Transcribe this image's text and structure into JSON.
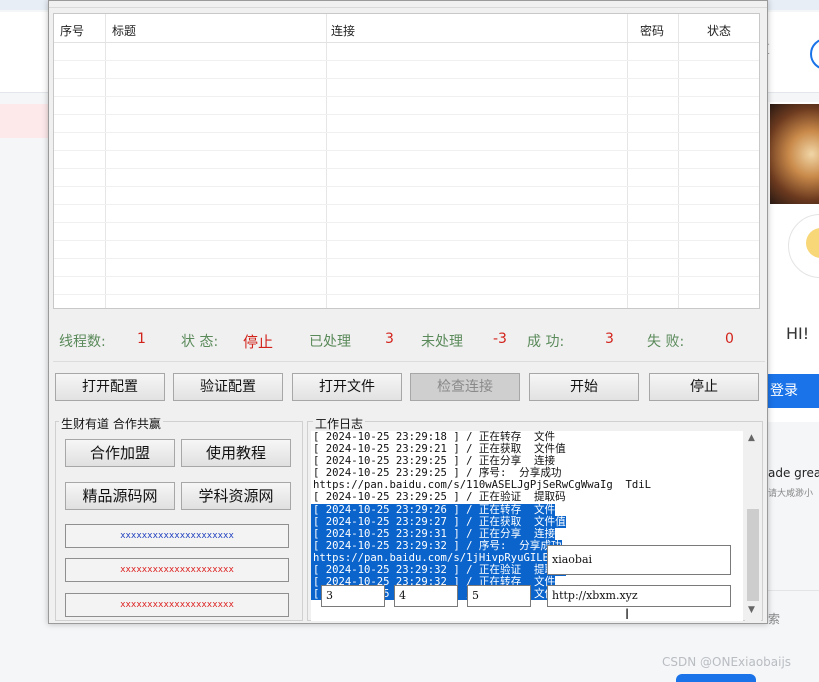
{
  "background": {
    "hi_text": "HI!",
    "login_label": "登录",
    "snippet1": "ade grea",
    "snippet2": "请大咸渺小",
    "snippet3": "索",
    "watermark": "CSDN @ONExiaobaijs"
  },
  "grid": {
    "columns": [
      "序号",
      "标题",
      "连接",
      "密码",
      "状态"
    ]
  },
  "stats": {
    "threads_label": "线程数:",
    "threads_value": "1",
    "status_label": "状 态:",
    "status_value": "停止",
    "processed_label": "已处理",
    "processed_value": "3",
    "unprocessed_label": "未处理",
    "unprocessed_value": "-3",
    "success_label": "成 功:",
    "success_value": "3",
    "fail_label": "失 败:",
    "fail_value": "0"
  },
  "toolbar": {
    "open_config": "打开配置",
    "verify_config": "验证配置",
    "open_file": "打开文件",
    "check_link": "检查连接",
    "start": "开始",
    "stop": "停止"
  },
  "left_panel": {
    "title": "生财有道 合作共赢",
    "join": "合作加盟",
    "tutorial": "使用教程",
    "source_site": "精品源码网",
    "resource_site": "学科资源网",
    "x_buttons": [
      "xxxxxxxxxxxxxxxxxxxxx",
      "xxxxxxxxxxxxxxxxxxxxx",
      "xxxxxxxxxxxxxxxxxxxxx"
    ],
    "x_colors": [
      "#1f3fbf",
      "#d22",
      "#d22"
    ]
  },
  "log_panel": {
    "title": "工作日志",
    "lines": [
      "[ 2024-10-25 23:29:18 ] / 正在转存  文件",
      "[ 2024-10-25 23:29:21 ] / 正在获取  文件值",
      "[ 2024-10-25 23:29:25 ] / 正在分享  连接",
      "[ 2024-10-25 23:29:25 ] / 序号:  分享成功",
      "https://pan.baidu.com/s/110wASELJgPjSeRwCgWwaIg  TdiL",
      "[ 2024-10-25 23:29:25 ] / 正在验证  提取码",
      "[ 2024-10-25 23:29:26 ] / 正在转存  文件",
      "[ 2024-10-25 23:29:27 ] / 正在获取  文件值",
      "[ 2024-10-25 23:29:31 ] / 正在分享  连接",
      "[ 2024-10-25 23:29:32 ] / 序号:  分享成功",
      "https://pan.baidu.com/s/1jHivpRyuGILBjW",
      "[ 2024-10-25 23:29:32 ] / 正在验证  提取码",
      "[ 2024-10-25 23:29:32 ] / 正在转存  文件",
      "[ 2024-10-25 23:29:32 ] / 正在获取  文件值"
    ],
    "selected_from": 6,
    "input_a": "3",
    "input_b": "4",
    "input_c": "5",
    "input_name": "xiaobai",
    "input_url": "http://xbxm.xyz"
  }
}
